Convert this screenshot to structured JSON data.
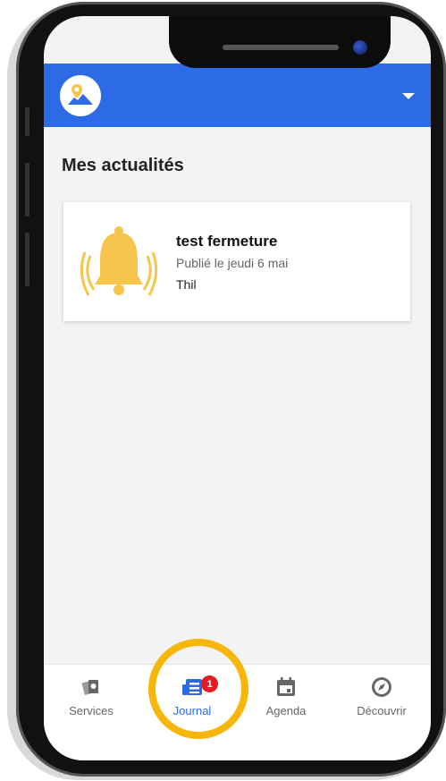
{
  "header": {
    "logo_icon": "map-pin-mountain-icon",
    "menu_icon": "caret-down-icon",
    "bar_color": "#2d6be6"
  },
  "main": {
    "title": "Mes actualités",
    "news": [
      {
        "icon": "bell-icon",
        "title": "test fermeture",
        "date": "Publié le jeudi 6 mai",
        "place": "Thil"
      }
    ]
  },
  "bottom_nav": {
    "items": [
      {
        "label": "Services",
        "icon": "services-icon",
        "active": false
      },
      {
        "label": "Journal",
        "icon": "journal-icon",
        "active": true,
        "badge": "1"
      },
      {
        "label": "Agenda",
        "icon": "calendar-icon",
        "active": false
      },
      {
        "label": "Découvrir",
        "icon": "compass-icon",
        "active": false
      }
    ]
  },
  "colors": {
    "accent": "#2d6be6",
    "badge": "#e31b23",
    "highlight": "#f6b60a",
    "bell": "#f7c44c"
  }
}
